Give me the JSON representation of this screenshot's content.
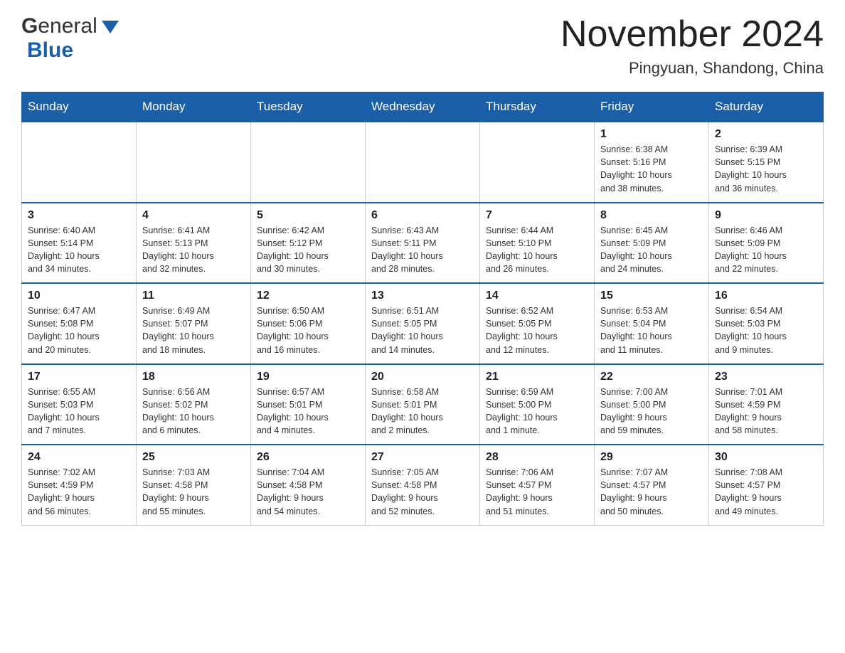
{
  "header": {
    "title": "November 2024",
    "subtitle": "Pingyuan, Shandong, China",
    "logo_general": "General",
    "logo_blue": "Blue"
  },
  "weekdays": [
    "Sunday",
    "Monday",
    "Tuesday",
    "Wednesday",
    "Thursday",
    "Friday",
    "Saturday"
  ],
  "weeks": [
    [
      {
        "day": "",
        "info": ""
      },
      {
        "day": "",
        "info": ""
      },
      {
        "day": "",
        "info": ""
      },
      {
        "day": "",
        "info": ""
      },
      {
        "day": "",
        "info": ""
      },
      {
        "day": "1",
        "info": "Sunrise: 6:38 AM\nSunset: 5:16 PM\nDaylight: 10 hours\nand 38 minutes."
      },
      {
        "day": "2",
        "info": "Sunrise: 6:39 AM\nSunset: 5:15 PM\nDaylight: 10 hours\nand 36 minutes."
      }
    ],
    [
      {
        "day": "3",
        "info": "Sunrise: 6:40 AM\nSunset: 5:14 PM\nDaylight: 10 hours\nand 34 minutes."
      },
      {
        "day": "4",
        "info": "Sunrise: 6:41 AM\nSunset: 5:13 PM\nDaylight: 10 hours\nand 32 minutes."
      },
      {
        "day": "5",
        "info": "Sunrise: 6:42 AM\nSunset: 5:12 PM\nDaylight: 10 hours\nand 30 minutes."
      },
      {
        "day": "6",
        "info": "Sunrise: 6:43 AM\nSunset: 5:11 PM\nDaylight: 10 hours\nand 28 minutes."
      },
      {
        "day": "7",
        "info": "Sunrise: 6:44 AM\nSunset: 5:10 PM\nDaylight: 10 hours\nand 26 minutes."
      },
      {
        "day": "8",
        "info": "Sunrise: 6:45 AM\nSunset: 5:09 PM\nDaylight: 10 hours\nand 24 minutes."
      },
      {
        "day": "9",
        "info": "Sunrise: 6:46 AM\nSunset: 5:09 PM\nDaylight: 10 hours\nand 22 minutes."
      }
    ],
    [
      {
        "day": "10",
        "info": "Sunrise: 6:47 AM\nSunset: 5:08 PM\nDaylight: 10 hours\nand 20 minutes."
      },
      {
        "day": "11",
        "info": "Sunrise: 6:49 AM\nSunset: 5:07 PM\nDaylight: 10 hours\nand 18 minutes."
      },
      {
        "day": "12",
        "info": "Sunrise: 6:50 AM\nSunset: 5:06 PM\nDaylight: 10 hours\nand 16 minutes."
      },
      {
        "day": "13",
        "info": "Sunrise: 6:51 AM\nSunset: 5:05 PM\nDaylight: 10 hours\nand 14 minutes."
      },
      {
        "day": "14",
        "info": "Sunrise: 6:52 AM\nSunset: 5:05 PM\nDaylight: 10 hours\nand 12 minutes."
      },
      {
        "day": "15",
        "info": "Sunrise: 6:53 AM\nSunset: 5:04 PM\nDaylight: 10 hours\nand 11 minutes."
      },
      {
        "day": "16",
        "info": "Sunrise: 6:54 AM\nSunset: 5:03 PM\nDaylight: 10 hours\nand 9 minutes."
      }
    ],
    [
      {
        "day": "17",
        "info": "Sunrise: 6:55 AM\nSunset: 5:03 PM\nDaylight: 10 hours\nand 7 minutes."
      },
      {
        "day": "18",
        "info": "Sunrise: 6:56 AM\nSunset: 5:02 PM\nDaylight: 10 hours\nand 6 minutes."
      },
      {
        "day": "19",
        "info": "Sunrise: 6:57 AM\nSunset: 5:01 PM\nDaylight: 10 hours\nand 4 minutes."
      },
      {
        "day": "20",
        "info": "Sunrise: 6:58 AM\nSunset: 5:01 PM\nDaylight: 10 hours\nand 2 minutes."
      },
      {
        "day": "21",
        "info": "Sunrise: 6:59 AM\nSunset: 5:00 PM\nDaylight: 10 hours\nand 1 minute."
      },
      {
        "day": "22",
        "info": "Sunrise: 7:00 AM\nSunset: 5:00 PM\nDaylight: 9 hours\nand 59 minutes."
      },
      {
        "day": "23",
        "info": "Sunrise: 7:01 AM\nSunset: 4:59 PM\nDaylight: 9 hours\nand 58 minutes."
      }
    ],
    [
      {
        "day": "24",
        "info": "Sunrise: 7:02 AM\nSunset: 4:59 PM\nDaylight: 9 hours\nand 56 minutes."
      },
      {
        "day": "25",
        "info": "Sunrise: 7:03 AM\nSunset: 4:58 PM\nDaylight: 9 hours\nand 55 minutes."
      },
      {
        "day": "26",
        "info": "Sunrise: 7:04 AM\nSunset: 4:58 PM\nDaylight: 9 hours\nand 54 minutes."
      },
      {
        "day": "27",
        "info": "Sunrise: 7:05 AM\nSunset: 4:58 PM\nDaylight: 9 hours\nand 52 minutes."
      },
      {
        "day": "28",
        "info": "Sunrise: 7:06 AM\nSunset: 4:57 PM\nDaylight: 9 hours\nand 51 minutes."
      },
      {
        "day": "29",
        "info": "Sunrise: 7:07 AM\nSunset: 4:57 PM\nDaylight: 9 hours\nand 50 minutes."
      },
      {
        "day": "30",
        "info": "Sunrise: 7:08 AM\nSunset: 4:57 PM\nDaylight: 9 hours\nand 49 minutes."
      }
    ]
  ]
}
